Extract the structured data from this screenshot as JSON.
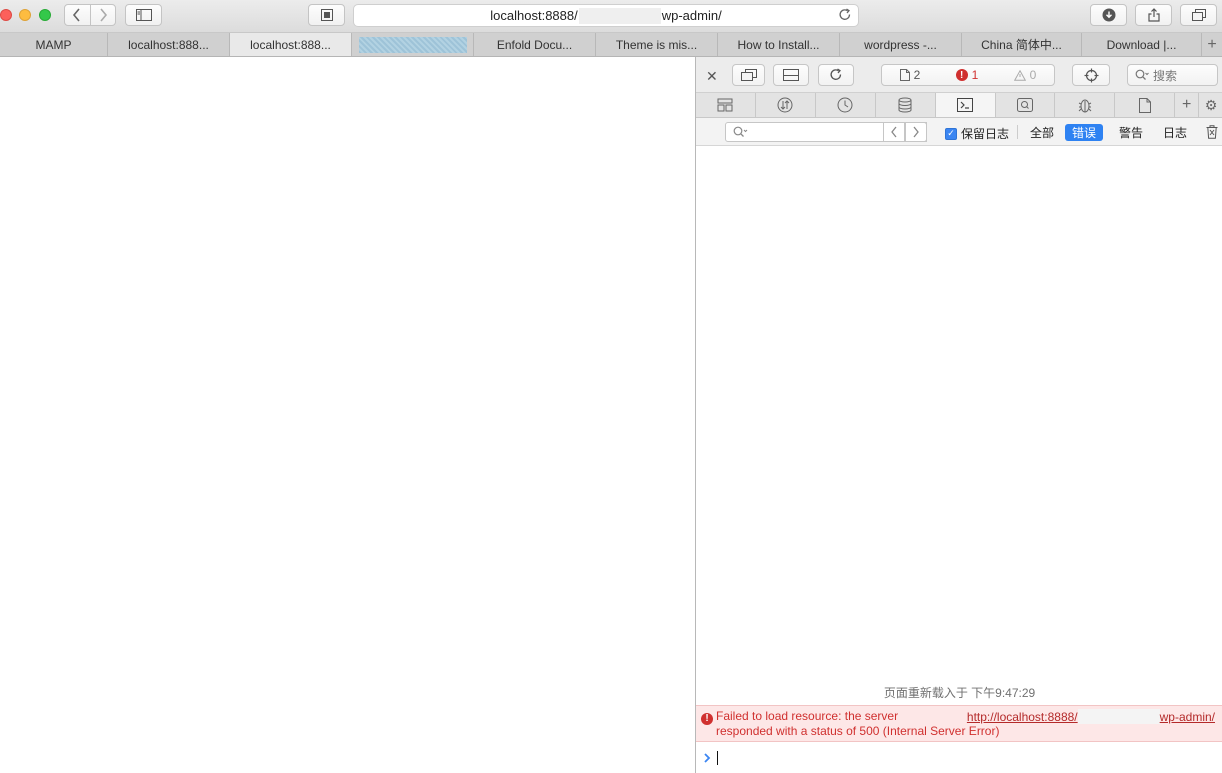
{
  "browser": {
    "url_prefix": "localhost:8888/",
    "url_suffix": "wp-admin/"
  },
  "tabs": [
    {
      "label": "MAMP"
    },
    {
      "label": "localhost:888..."
    },
    {
      "label": "localhost:888..."
    },
    {
      "label": ""
    },
    {
      "label": "Enfold Docu..."
    },
    {
      "label": "Theme is mis..."
    },
    {
      "label": "How to Install..."
    },
    {
      "label": "wordpress -..."
    },
    {
      "label": "China 简体中..."
    },
    {
      "label": "Download |..."
    }
  ],
  "inspector": {
    "counts": {
      "resources": "2",
      "errors": "1",
      "warnings": "0"
    },
    "search_placeholder": "搜索",
    "filter": {
      "preserve_log": "保留日志",
      "options": [
        "全部",
        "错误",
        "警告",
        "日志"
      ],
      "active_index": 1
    },
    "console": {
      "reload_note": "页面重新载入于 下午9:47:29",
      "error": {
        "message_line1": "Failed to load resource: the server",
        "message_line2": "responded with a status of 500 (Internal Server Error)",
        "link_prefix": "http://localhost:8888/",
        "link_suffix": "wp-admin/"
      }
    }
  },
  "colors": {
    "accent": "#2e82f2",
    "error": "#d0302f",
    "error_bg": "#fde7e7"
  }
}
